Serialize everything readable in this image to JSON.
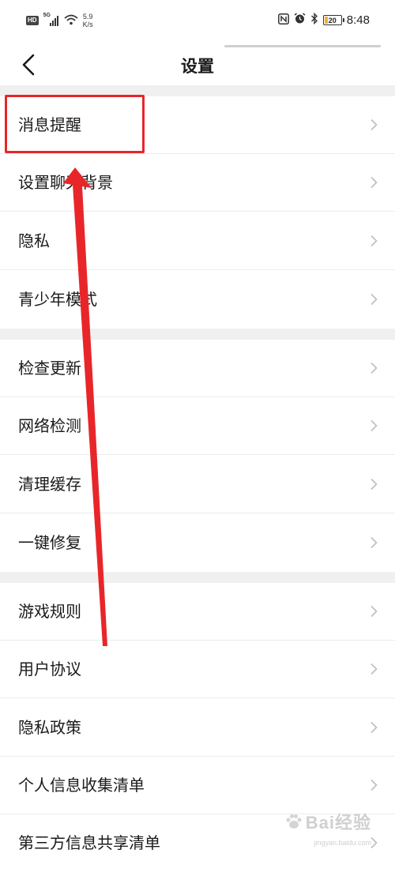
{
  "status_bar": {
    "hd": "HD",
    "network": "5G",
    "speed_value": "5.9",
    "speed_unit": "K/s",
    "battery_level": "20",
    "time": "8:48"
  },
  "header": {
    "title": "设置"
  },
  "settings": {
    "items": [
      {
        "label": "消息提醒"
      },
      {
        "label": "设置聊天背景"
      },
      {
        "label": "隐私"
      },
      {
        "label": "青少年模式"
      },
      {
        "label": "检查更新"
      },
      {
        "label": "网络检测"
      },
      {
        "label": "清理缓存"
      },
      {
        "label": "一键修复"
      },
      {
        "label": "游戏规则"
      },
      {
        "label": "用户协议"
      },
      {
        "label": "隐私政策"
      },
      {
        "label": "个人信息收集清单"
      },
      {
        "label": "第三方信息共享清单"
      }
    ]
  },
  "annotation": {
    "color": "#e8262a"
  },
  "watermark": {
    "brand": "Bai经验",
    "site": "jingyan.baidu.com"
  },
  "colors": {
    "section_gap": "#f0f0f0",
    "divider": "#ececec",
    "chevron": "#bdbdbd",
    "battery": "#f2b233"
  }
}
